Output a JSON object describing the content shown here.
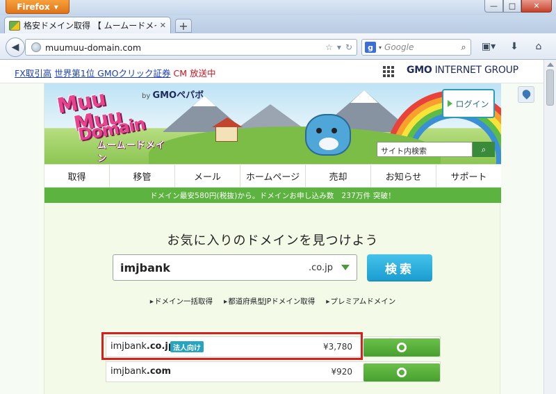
{
  "window": {
    "app_button": "Firefox",
    "minimize_glyph": "—",
    "maximize_glyph": "□",
    "close_glyph": "✕"
  },
  "tabs": [
    {
      "title": "格安ドメイン取得 【 ムームードメイ...",
      "close_glyph": "✕",
      "icon": "site-favicon"
    }
  ],
  "new_tab_glyph": "+",
  "navbar": {
    "url": "muumuu-domain.com",
    "search_engine": "g",
    "search_placeholder": "Google",
    "icons": [
      "back-icon",
      "globe-icon",
      "star-icon",
      "reload-icon",
      "bookmarks-icon",
      "download-icon",
      "home-icon"
    ]
  },
  "adbar": {
    "link_prefix": "FX取引高",
    "link_main": "世界第1位 GMOクリック証券",
    "link_suffix": "CM 放送中",
    "group_logo_bold": "GMO",
    "group_logo_rest": "INTERNET GROUP"
  },
  "site": {
    "logo_line1": "Muu",
    "logo_line2": "Muu",
    "logo_line3": "Domain",
    "logo_kana": "ムームードメイン",
    "byline_small": "by",
    "byline_brand": "GMOペパボ",
    "login_label": "ログイン",
    "site_search_placeholder": "サイト内検索",
    "nav": [
      "取得",
      "移管",
      "メール",
      "ホームページ",
      "売却",
      "お知らせ",
      "サポート"
    ],
    "banner": "ドメイン最安580円(税抜)から。ドメインお申し込み数　237万件 突破！",
    "find_title": "お気に入りのドメインを見つけよう",
    "domain_input": "imjbank",
    "tld": ".co.jp",
    "search_button": "検索",
    "sub_links": [
      "ドメイン一括取得",
      "都道府県型JPドメイン取得",
      "プレミアムドメイン"
    ]
  },
  "results": [
    {
      "name": "imjbank",
      "tld": ".co.jp",
      "badge": "法人向け",
      "price": "¥3,780",
      "highlighted": true
    },
    {
      "name": "imjbank",
      "tld": ".com",
      "badge": "",
      "price": "¥920",
      "highlighted": false
    }
  ],
  "colors": {
    "accent_green": "#5db33f",
    "search_blue": "#1a9dd1",
    "highlight_red": "#d81e1e"
  }
}
